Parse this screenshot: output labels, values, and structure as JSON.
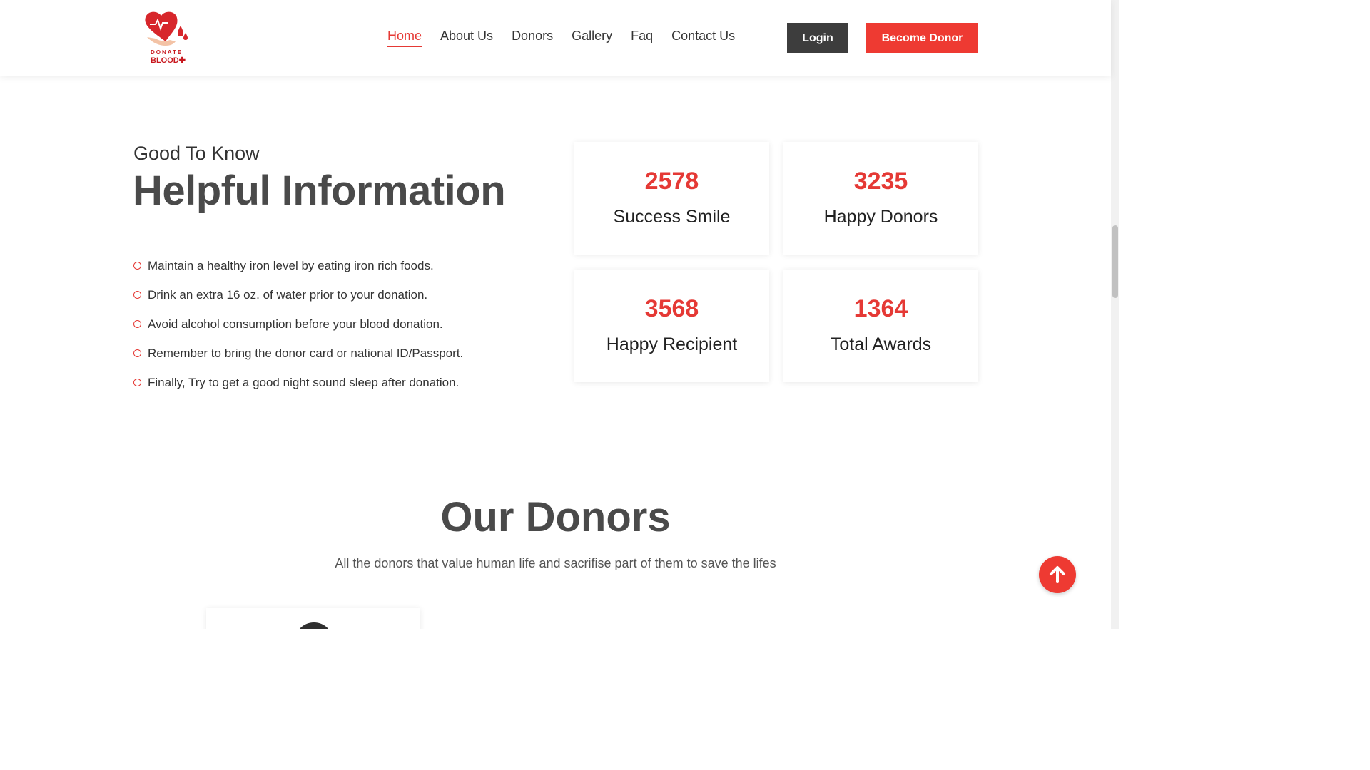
{
  "header": {
    "logo": {
      "line1": "DONATE",
      "line2": "BLOOD"
    },
    "nav": [
      {
        "label": "Home",
        "active": true
      },
      {
        "label": "About Us",
        "active": false
      },
      {
        "label": "Donors",
        "active": false
      },
      {
        "label": "Gallery",
        "active": false
      },
      {
        "label": "Faq",
        "active": false
      },
      {
        "label": "Contact Us",
        "active": false
      }
    ],
    "login_label": "Login",
    "become_donor_label": "Become Donor"
  },
  "info": {
    "subtitle": "Good To Know",
    "title": "Helpful Information",
    "tips": [
      "Maintain a healthy iron level by eating iron rich foods.",
      "Drink an extra 16 oz. of water prior to your donation.",
      "Avoid alcohol consumption before your blood donation.",
      "Remember to bring the donor card or national ID/Passport.",
      "Finally, Try to get a good night sound sleep after donation."
    ]
  },
  "stats": [
    {
      "value": "2578",
      "label": "Success Smile"
    },
    {
      "value": "3235",
      "label": "Happy Donors"
    },
    {
      "value": "3568",
      "label": "Happy Recipient"
    },
    {
      "value": "1364",
      "label": "Total Awards"
    }
  ],
  "donors": {
    "title": "Our Donors",
    "subtitle": "All the donors that value human life and sacrifise part of them to save the lifes"
  },
  "colors": {
    "accent": "#ee3a32",
    "dark": "#3d3d3d"
  },
  "icons": {
    "scroll_top": "arrow-up-icon",
    "logo": "heart-blood-drop-icon"
  }
}
